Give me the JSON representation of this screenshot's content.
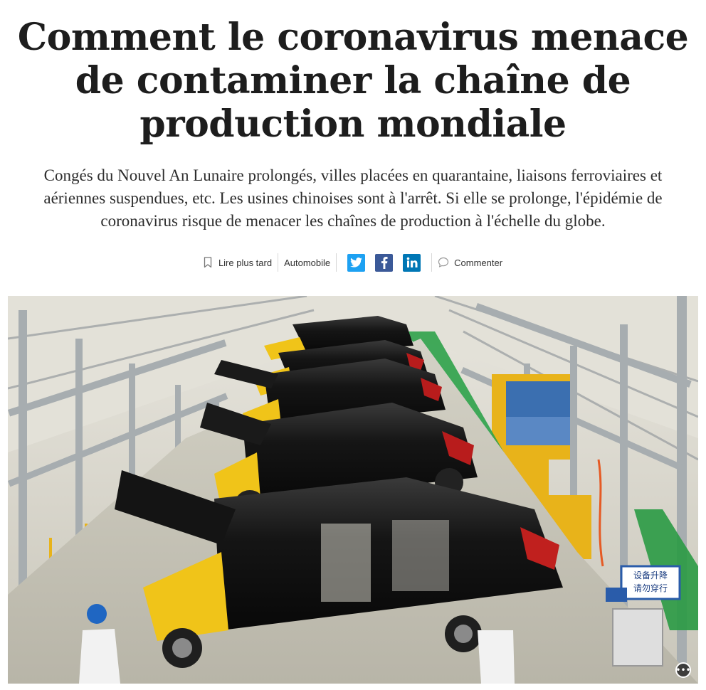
{
  "article": {
    "title": "Comment le coronavirus menace de contaminer la chaîne de production mondiale",
    "lede": "Congés du Nouvel An Lunaire prolongés, villes placées en quarantaine, liaisons ferroviaires et aériennes suspendues, etc. Les usines chinoises sont à l'arrêt. Si elle se prolonge, l'épidémie de coronavirus risque de menacer les chaînes de production à l'échelle du globe."
  },
  "toolbar": {
    "read_later_label": "Lire plus tard",
    "category_label": "Automobile",
    "comment_label": "Commenter",
    "icons": {
      "bookmark": "bookmark-icon",
      "twitter": "twitter-icon",
      "facebook": "facebook-icon",
      "linkedin": "linkedin-icon",
      "comment": "comment-icon"
    },
    "colors": {
      "twitter": "#1DA1F2",
      "facebook": "#3B5998",
      "linkedin": "#0077B5"
    }
  },
  "hero_image": {
    "signs": {
      "line1": "设备升降",
      "line2": "请勿穿行"
    },
    "more_button_icon": "more-options-icon"
  }
}
